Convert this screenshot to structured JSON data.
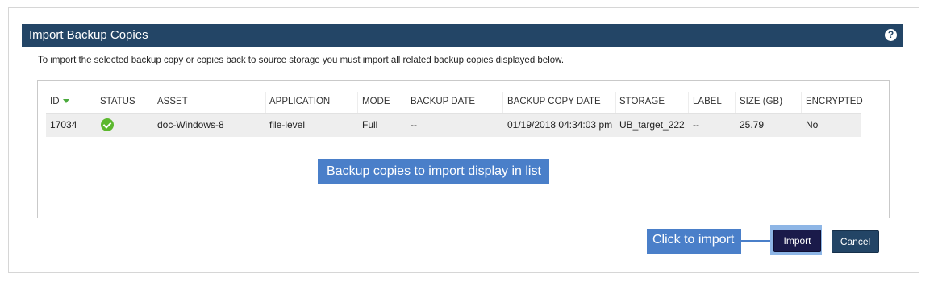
{
  "dialog": {
    "title": "Import Backup Copies",
    "help_icon": "question-circle-icon",
    "instructions": "To import the selected backup copy or copies back to source storage you must import all related backup copies displayed below."
  },
  "table": {
    "columns": [
      "ID",
      "STATUS",
      "ASSET",
      "APPLICATION",
      "MODE",
      "BACKUP DATE",
      "BACKUP COPY DATE",
      "STORAGE",
      "LABEL",
      "SIZE (GB)",
      "ENCRYPTED"
    ],
    "sort_column": "ID",
    "sort_direction": "descending",
    "rows": [
      {
        "id": "17034",
        "status_icon": "check-circle-icon",
        "asset": "doc-Windows-8",
        "application": "file-level",
        "mode": "Full",
        "backup_date": "--",
        "backup_copy_date": "01/19/2018 04:34:03 pm",
        "storage": "UB_target_222",
        "label": "--",
        "size_gb": "25.79",
        "encrypted": "No"
      }
    ]
  },
  "callouts": {
    "list": "Backup copies to import display in list",
    "import": "Click to import"
  },
  "buttons": {
    "import": "Import",
    "cancel": "Cancel"
  },
  "colors": {
    "header_bg": "#234566",
    "callout_bg": "#4a7fc9",
    "import_button": "#1a1a4a",
    "status_ok": "#5cb82e",
    "row_bg": "#eeeeee"
  }
}
